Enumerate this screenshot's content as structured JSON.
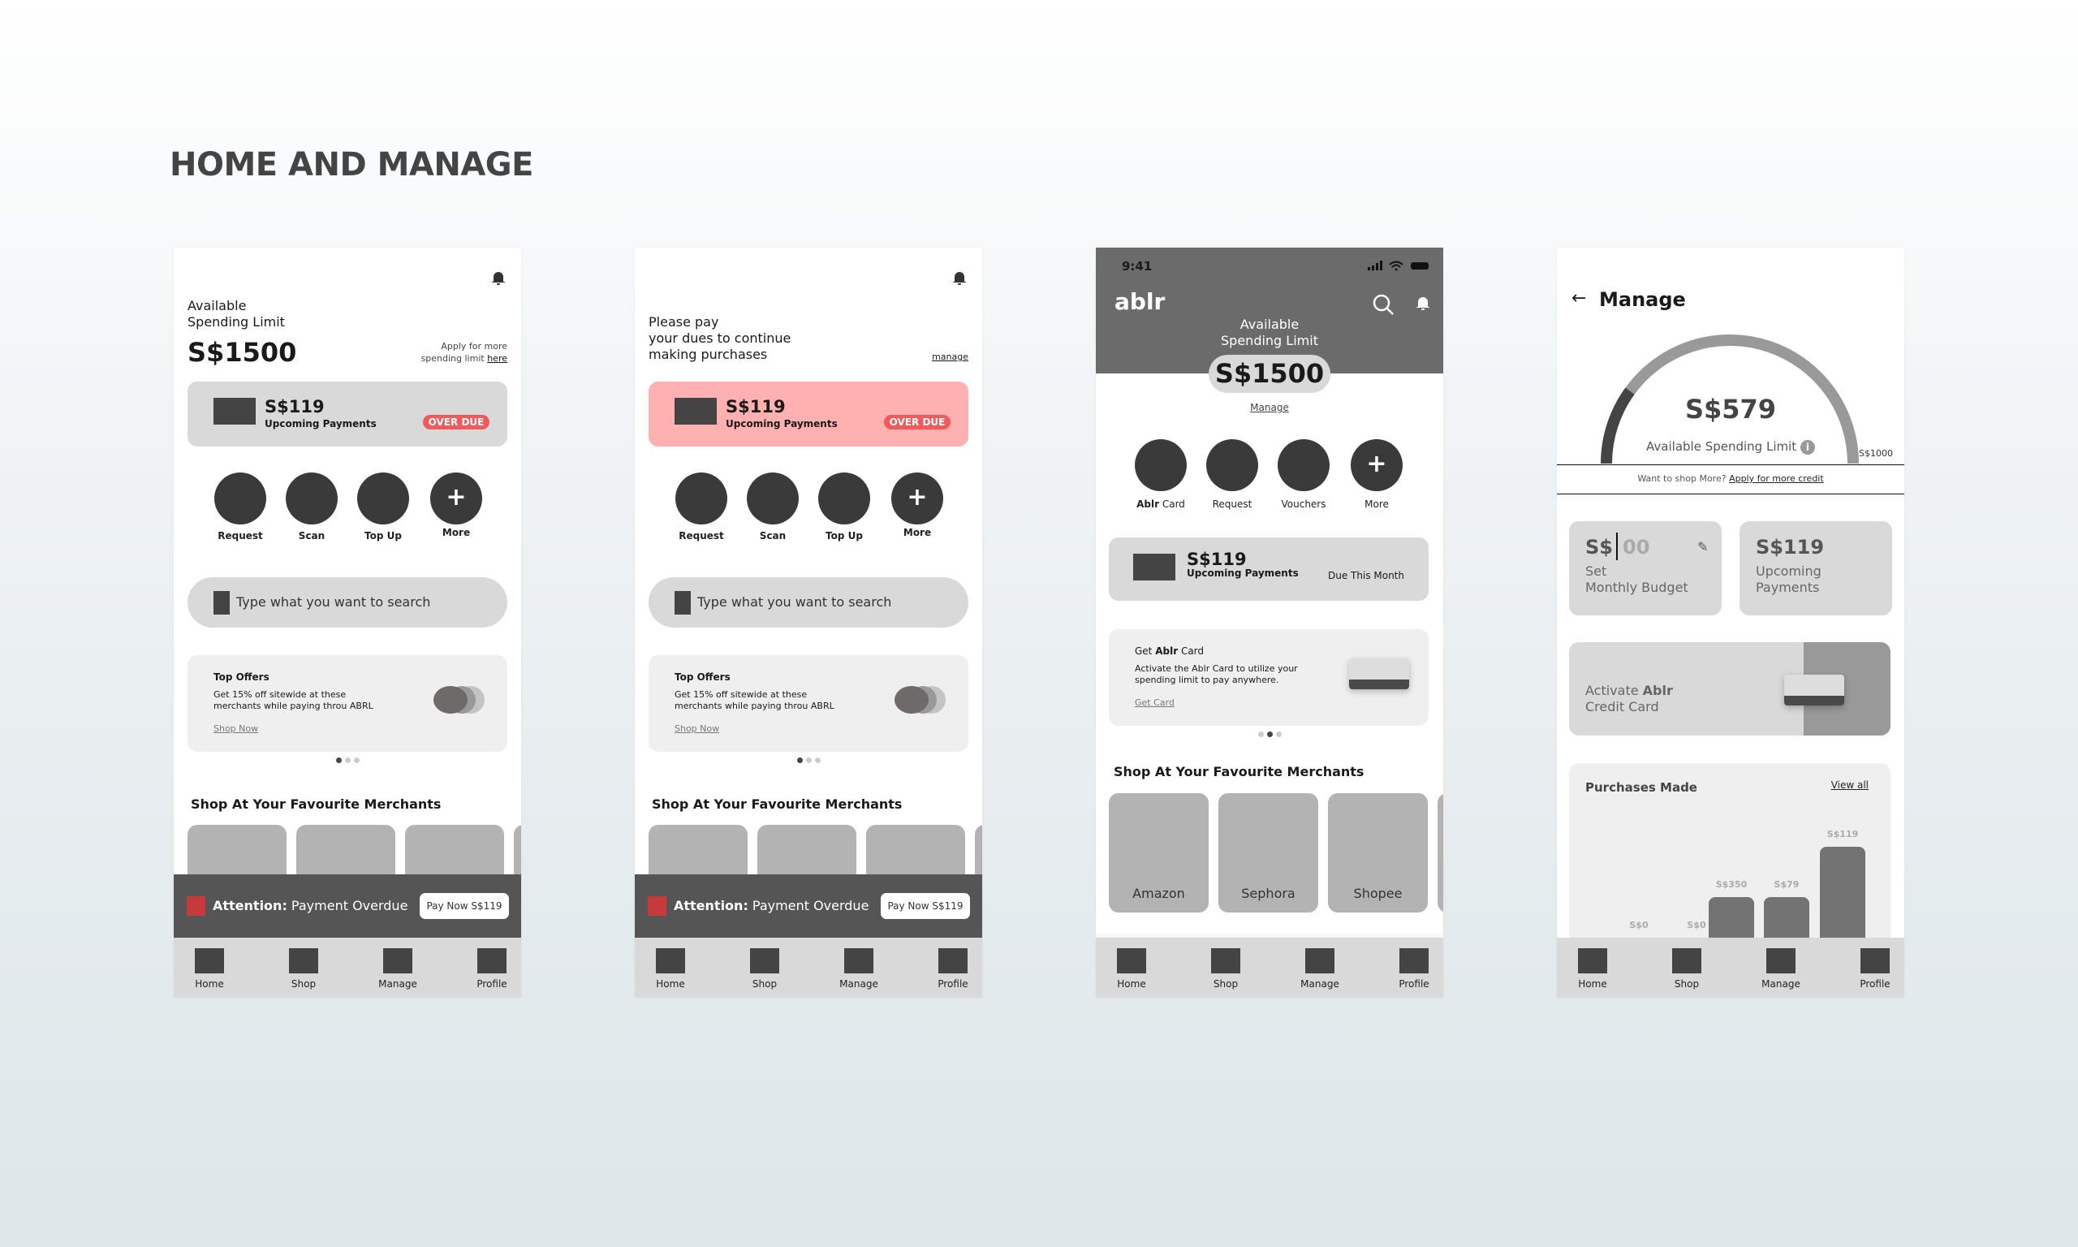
{
  "page_title": "HOME AND MANAGE",
  "colors": {
    "overdue_red": "#ef5b5b",
    "overdue_card": "#ffb0b0",
    "header_gray": "#6b6b6b",
    "attention_square": "#c83a3a"
  },
  "nav": [
    "Home",
    "Shop",
    "Manage",
    "Profile"
  ],
  "phone1": {
    "heading_line1": "Available",
    "heading_line2": "Spending Limit",
    "amount": "S$1500",
    "apply_line1": "Apply for more",
    "apply_line2": "spending limit ",
    "apply_link": "here",
    "upcoming": {
      "amount": "S$119",
      "label": "Upcoming Payments",
      "badge": "OVER DUE"
    },
    "actions": [
      "Request",
      "Scan",
      "Top Up",
      "More"
    ],
    "search_placeholder": "Type what you want to search",
    "offer": {
      "title": "Top Offers",
      "line1": "Get 15% off sitewide at these",
      "line2": "merchants while paying throu ABRL",
      "link": "Shop Now"
    },
    "merchants_title": "Shop At Your Favourite Merchants",
    "attention": {
      "bold": "Attention:",
      "text": " Payment Overdue",
      "button": "Pay Now S$119"
    }
  },
  "phone2": {
    "heading_line1": "Please pay",
    "heading_line2": "your dues to continue",
    "heading_line3": "making purchases",
    "manage_link": "manage",
    "upcoming": {
      "amount": "S$119",
      "label": "Upcoming Payments",
      "badge": "OVER DUE"
    },
    "actions": [
      "Request",
      "Scan",
      "Top Up",
      "More"
    ],
    "search_placeholder": "Type what you want to search",
    "offer": {
      "title": "Top Offers",
      "line1": "Get 15% off sitewide at these",
      "line2": "merchants while paying throu ABRL",
      "link": "Shop Now"
    },
    "merchants_title": "Shop At Your Favourite Merchants",
    "attention": {
      "bold": "Attention:",
      "text": " Payment Overdue",
      "button": "Pay Now S$119"
    }
  },
  "phone3": {
    "time": "9:41",
    "logo": "ablr",
    "heading_line1": "Available",
    "heading_line2": "Spending Limit",
    "amount": "S$1500",
    "manage_link": "Manage",
    "actions": [
      {
        "bold": "Ablr",
        "label": " Card"
      },
      {
        "bold": "",
        "label": "Request"
      },
      {
        "bold": "",
        "label": "Vouchers"
      },
      {
        "bold": "",
        "label": "More"
      }
    ],
    "upcoming": {
      "amount": "S$119",
      "label": "Upcoming Payments",
      "due": "Due This Month"
    },
    "promo": {
      "title_pre": "Get ",
      "title_bold": "Ablr",
      "title_post": " Card",
      "line1": "Activate the Ablr Card to utilize your",
      "line2": "spending limit to pay anywhere.",
      "link": "Get Card"
    },
    "merchants_title": "Shop At Your Favourite Merchants",
    "merchants": [
      "Amazon",
      "Sephora",
      "Shopee"
    ]
  },
  "phone4": {
    "title": "Manage",
    "gauge": {
      "amount": "S$579",
      "label": "Available Spending Limit",
      "max": "S$1000",
      "used_fraction": 0.2
    },
    "credit_text": "Want to shop More? ",
    "credit_link": "Apply for more credit",
    "budget": {
      "prefix": "S$",
      "placeholder": "00",
      "line1": "Set",
      "line2": "Monthly Budget"
    },
    "upcoming": {
      "amount": "S$119",
      "line1": "Upcoming",
      "line2": "Payments"
    },
    "activate": {
      "pre": "Activate ",
      "bold": "Ablr",
      "line2": "Credit Card"
    },
    "purchases": {
      "title": "Purchases Made",
      "link": "View all",
      "bars": [
        "S$0",
        "S$0",
        "S$350",
        "S$79",
        "S$119"
      ]
    }
  }
}
